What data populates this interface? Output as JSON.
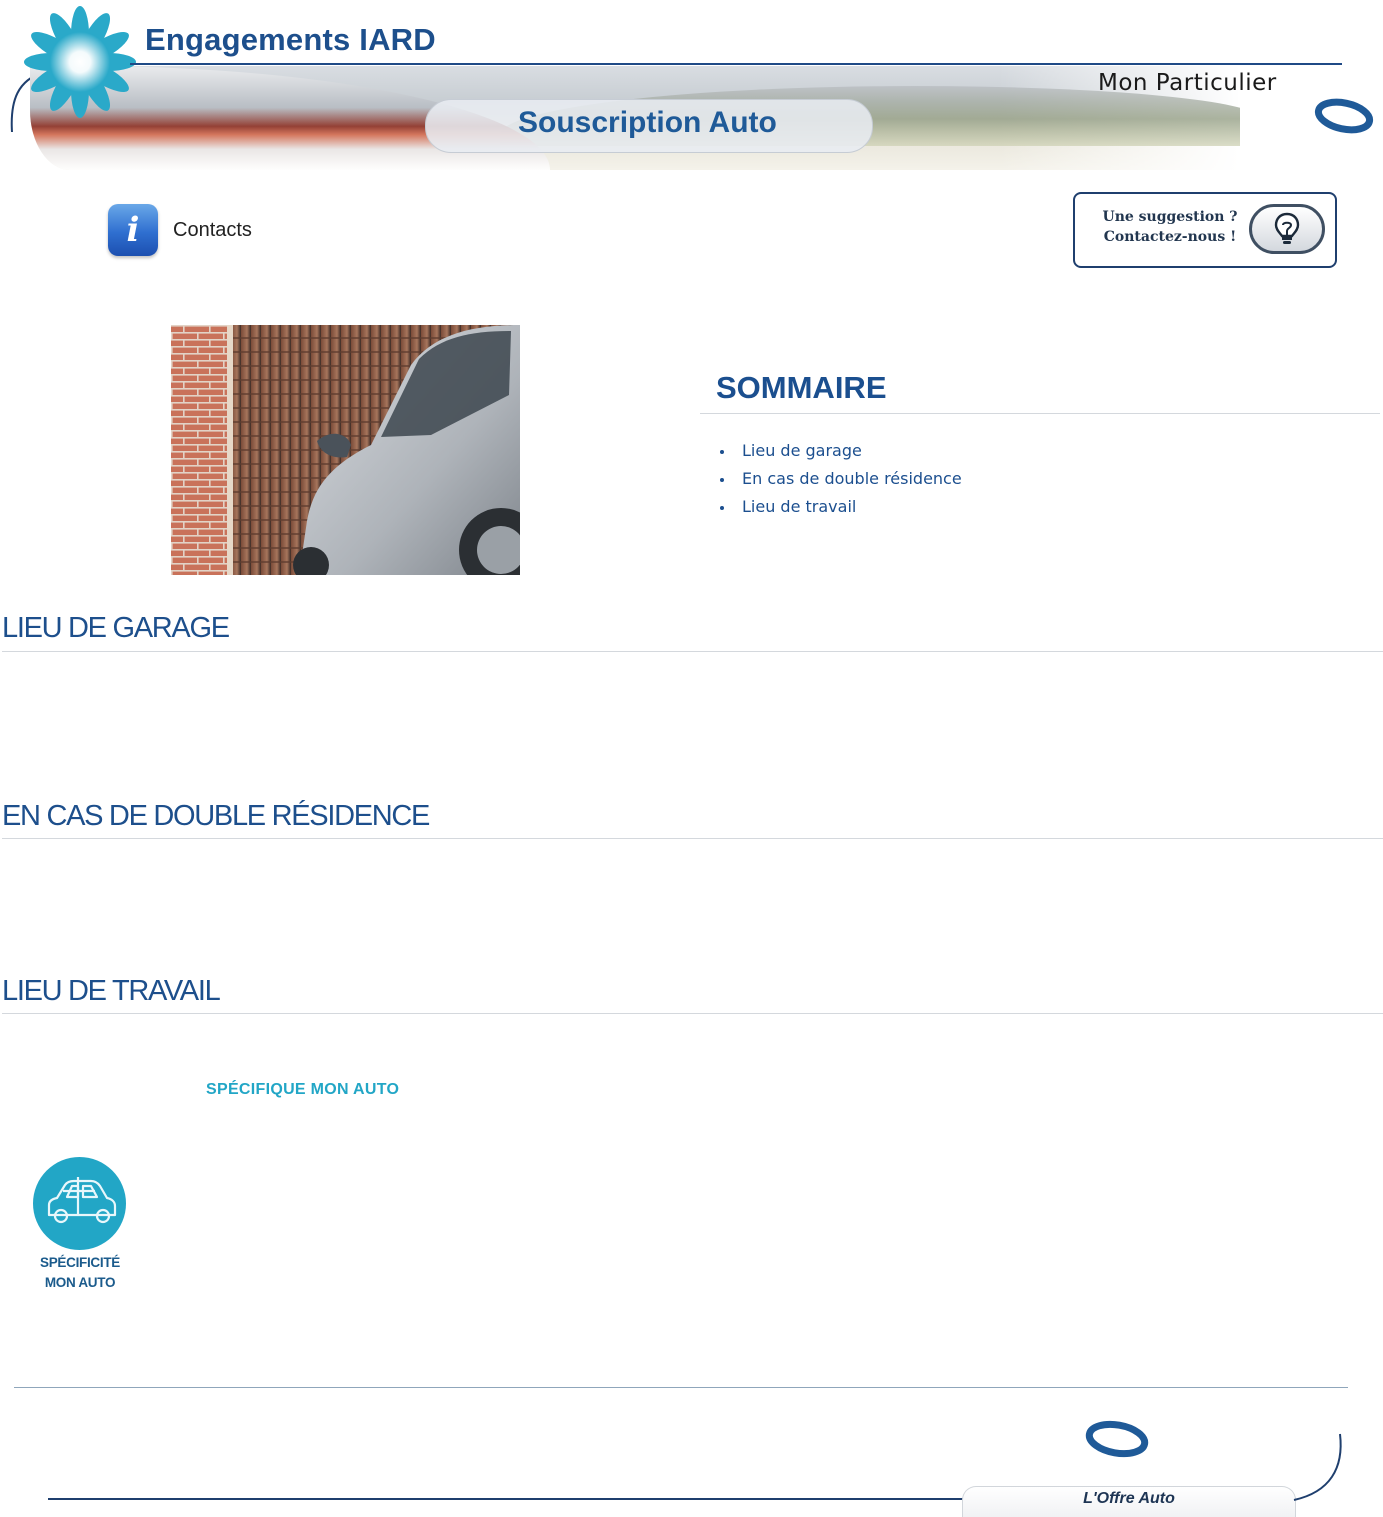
{
  "header": {
    "app_title": "Engagements IARD",
    "brand_name": "Mon Particulier",
    "subtitle": "Souscription Auto"
  },
  "tools": {
    "contacts_label": "Contacts",
    "suggestion_line1": "Une suggestion ?",
    "suggestion_line2": "Contactez-nous !"
  },
  "toc": {
    "title": "SOMMAIRE",
    "items": [
      "Lieu de garage",
      "En cas de double résidence",
      "Lieu de travail"
    ]
  },
  "sections": [
    {
      "title": "LIEU DE GARAGE"
    },
    {
      "title": "EN CAS DE DOUBLE RÉSIDENCE"
    },
    {
      "title": "LIEU DE TRAVAIL"
    }
  ],
  "specific": {
    "label": "SPÉCIFIQUE MON AUTO",
    "badge_line1": "SPÉCIFICITÉ",
    "badge_line2": "MON AUTO"
  },
  "footer": {
    "tab_label": "L'Offre Auto"
  },
  "colors": {
    "primary": "#1d4f8c",
    "accent": "#22a6c6",
    "rule": "#d4d8dd"
  },
  "icons": {
    "logo": "flower-logo-icon",
    "ring": "ring-logo-icon",
    "info": "info-icon",
    "bulb": "lightbulb-icon",
    "car": "car-icon"
  }
}
